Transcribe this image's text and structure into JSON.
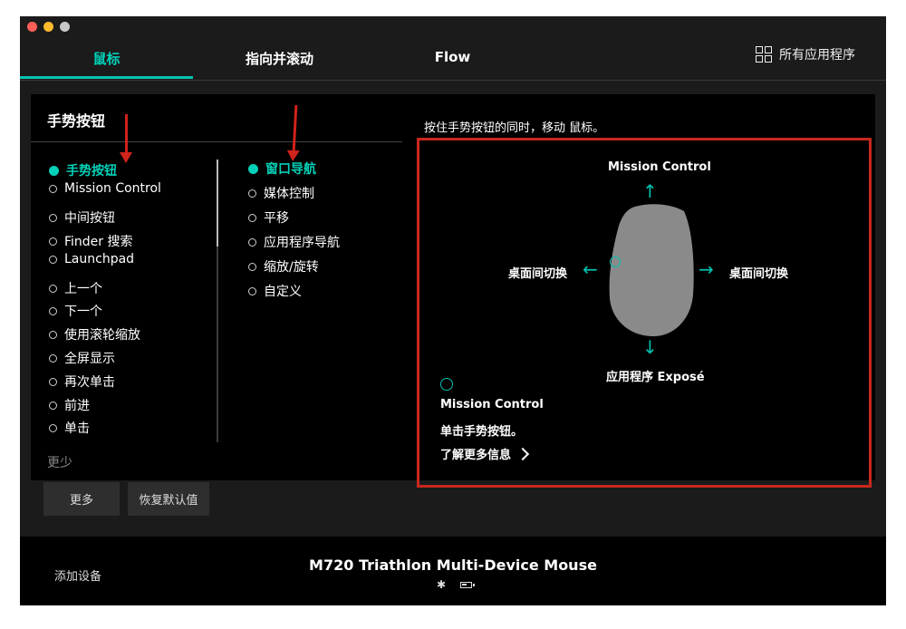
{
  "tabs": [
    {
      "label": "鼠标"
    },
    {
      "label": "指向并滚动"
    },
    {
      "label": "Flow"
    }
  ],
  "apps_label": "所有应用程序",
  "panel": {
    "title": "手势按钮",
    "hint": "按住手势按钮的同时，移动 鼠标。"
  },
  "col1": [
    {
      "label": "手势按钮"
    },
    {
      "label": "Mission Control"
    },
    {
      "label": "中间按钮"
    },
    {
      "label": "Finder 搜索"
    },
    {
      "label": "Launchpad"
    },
    {
      "label": "上一个"
    },
    {
      "label": "下一个"
    },
    {
      "label": "使用滚轮缩放"
    },
    {
      "label": "全屏显示"
    },
    {
      "label": "再次单击"
    },
    {
      "label": "前进"
    },
    {
      "label": "单击"
    }
  ],
  "less_label": "更少",
  "col2": [
    {
      "label": "窗口导航"
    },
    {
      "label": "媒体控制"
    },
    {
      "label": "平移"
    },
    {
      "label": "应用程序导航"
    },
    {
      "label": "缩放/旋转"
    },
    {
      "label": "自定义"
    }
  ],
  "gesture": {
    "up": "Mission Control",
    "down": "应用程序 Exposé",
    "left": "桌面间切换",
    "right": "桌面间切换",
    "click_title": "Mission Control",
    "click_desc": "单击手势按钮。",
    "learn_more": "了解更多信息"
  },
  "buttons": {
    "more": "更多",
    "reset": "恢复默认值"
  },
  "footer": {
    "add_device": "添加设备",
    "device_name": "M720 Triathlon Multi-Device Mouse",
    "bluetooth_glyph": "✱"
  },
  "colors": {
    "accent": "#00d1b8",
    "annotation_red": "#d0231b",
    "background": "#1b1b1b"
  }
}
